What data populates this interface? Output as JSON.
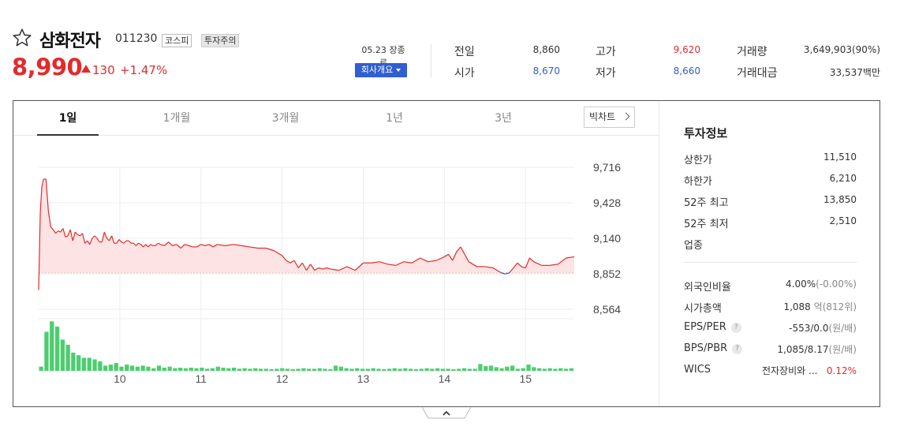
{
  "stock": {
    "name": "삼화전자",
    "code": "011230",
    "market_badge": "코스피",
    "warning_badge": "투자주의",
    "price": "8,990",
    "change": "130",
    "change_rate": "+1.47%",
    "close_info": "05.23 장종료",
    "company_button": "회사개요"
  },
  "quote": {
    "prev_label": "전일",
    "prev_value": "8,860",
    "open_label": "시가",
    "open_value": "8,670",
    "high_label": "고가",
    "high_value": "9,620",
    "low_label": "저가",
    "low_value": "8,660",
    "volume_label": "거래량",
    "volume_value": "3,649,903(90%)",
    "amount_label": "거래대금",
    "amount_value": "33,537백만"
  },
  "tabs": [
    {
      "label": "1일",
      "active": true
    },
    {
      "label": "1개월",
      "active": false
    },
    {
      "label": "3개월",
      "active": false
    },
    {
      "label": "1년",
      "active": false
    },
    {
      "label": "3년",
      "active": false
    }
  ],
  "candle_button": "빅차트",
  "side": {
    "title": "투자정보",
    "items": [
      {
        "label": "상한가",
        "value": "11,510"
      },
      {
        "label": "하한가",
        "value": "6,210"
      },
      {
        "label": "52주 최고",
        "value": "13,850"
      },
      {
        "label": "52주 최저",
        "value": "2,510"
      },
      {
        "label": "업종",
        "value": ""
      }
    ],
    "foreign_label": "외국인비율",
    "foreign_value": "4.00%",
    "foreign_sub": "(-0.00%)",
    "mcap_label": "시가총액",
    "mcap_value": "1,088",
    "mcap_unit": "억",
    "mcap_sub": "(812위)",
    "eps_label": "EPS/PER",
    "eps_value": "-553/0.0",
    "eps_sub": "(원/배)",
    "bps_label": "BPS/PBR",
    "bps_value": "1,085/8.17",
    "bps_sub": "(원/배)",
    "wics_label": "WICS",
    "wics_value": "전자장비와 ...",
    "wics_rate": "0.12%",
    "help_icon": "?"
  },
  "colors": {
    "up": "#e22b2b",
    "down": "#2f5fd0",
    "volume": "#4cce6e",
    "area": "#fde3e3"
  },
  "chart_data": {
    "type": "line",
    "title": "",
    "xlabel": "",
    "ylabel": "",
    "base_price": 8860,
    "ylim": [
      8564,
      9716
    ],
    "y_ticks": [
      9716,
      9428,
      9140,
      8852,
      8564
    ],
    "x_ticks": [
      10,
      11,
      12,
      13,
      14,
      15
    ],
    "x_range": [
      9.0,
      15.6
    ],
    "price_series": {
      "name": "",
      "x": [
        9.0,
        9.02,
        9.04,
        9.06,
        9.09,
        9.12,
        9.15,
        9.18,
        9.21,
        9.24,
        9.27,
        9.3,
        9.33,
        9.36,
        9.39,
        9.42,
        9.45,
        9.48,
        9.51,
        9.54,
        9.57,
        9.6,
        9.63,
        9.66,
        9.69,
        9.72,
        9.75,
        9.78,
        9.81,
        9.84,
        9.87,
        9.9,
        9.93,
        9.96,
        9.99,
        10.02,
        10.05,
        10.08,
        10.11,
        10.14,
        10.17,
        10.2,
        10.23,
        10.26,
        10.29,
        10.32,
        10.35,
        10.38,
        10.41,
        10.44,
        10.47,
        10.5,
        10.55,
        10.6,
        10.65,
        10.7,
        10.75,
        10.8,
        10.85,
        10.9,
        10.95,
        11.0,
        11.05,
        11.1,
        11.15,
        11.2,
        11.3,
        11.4,
        11.5,
        11.6,
        11.7,
        11.8,
        11.9,
        12.0,
        12.05,
        12.1,
        12.15,
        12.2,
        12.25,
        12.3,
        12.35,
        12.4,
        12.45,
        12.5,
        12.55,
        12.6,
        12.7,
        12.8,
        12.9,
        13.0,
        13.1,
        13.2,
        13.3,
        13.4,
        13.5,
        13.6,
        13.7,
        13.8,
        13.9,
        14.0,
        14.05,
        14.1,
        14.15,
        14.2,
        14.25,
        14.3,
        14.4,
        14.5,
        14.6,
        14.65,
        14.7,
        14.75,
        14.8,
        14.85,
        14.9,
        14.95,
        15.0,
        15.05,
        15.1,
        15.2,
        15.3,
        15.4,
        15.5,
        15.6
      ],
      "values": [
        8720,
        9350,
        9560,
        9620,
        9620,
        9360,
        9230,
        9210,
        9180,
        9200,
        9190,
        9220,
        9150,
        9160,
        9210,
        9120,
        9190,
        9170,
        9160,
        9180,
        9100,
        9120,
        9090,
        9140,
        9160,
        9140,
        9110,
        9110,
        9190,
        9140,
        9120,
        9160,
        9100,
        9100,
        9130,
        9110,
        9100,
        9120,
        9120,
        9100,
        9100,
        9080,
        9100,
        9090,
        9070,
        9090,
        9070,
        9090,
        9080,
        9080,
        9100,
        9090,
        9080,
        9110,
        9080,
        9090,
        9060,
        9090,
        9080,
        9070,
        9070,
        9090,
        9080,
        9090,
        9070,
        9090,
        9080,
        9090,
        9080,
        9070,
        9060,
        9060,
        9040,
        9000,
        8960,
        8940,
        8960,
        8900,
        8940,
        8880,
        8930,
        8880,
        8900,
        8890,
        8900,
        8890,
        8880,
        8910,
        8880,
        8940,
        8940,
        8950,
        8930,
        8920,
        8950,
        8940,
        8980,
        8950,
        8960,
        8990,
        9010,
        8960,
        9030,
        9070,
        9010,
        8950,
        8910,
        8910,
        8900,
        8880,
        8860,
        8850,
        8860,
        8900,
        8940,
        8910,
        8900,
        8980,
        8950,
        8920,
        8920,
        8930,
        8980,
        8990
      ]
    },
    "volume_series": {
      "name": "",
      "relative": [
        0.08,
        0.75,
        0.95,
        0.85,
        0.6,
        0.5,
        0.35,
        0.3,
        0.25,
        0.25,
        0.22,
        0.18,
        0.1,
        0.12,
        0.15,
        0.08,
        0.12,
        0.1,
        0.08,
        0.1,
        0.08,
        0.05,
        0.1,
        0.06,
        0.08,
        0.05,
        0.06,
        0.05,
        0.06,
        0.05,
        0.06,
        0.04,
        0.05,
        0.08,
        0.06,
        0.05,
        0.06,
        0.04,
        0.05,
        0.04,
        0.05,
        0.04,
        0.04,
        0.03,
        0.04,
        0.05,
        0.04,
        0.03,
        0.04,
        0.05,
        0.04,
        0.04,
        0.05,
        0.04,
        0.03,
        0.1,
        0.08,
        0.05,
        0.04,
        0.05,
        0.04,
        0.04,
        0.05,
        0.04,
        0.03,
        0.04,
        0.05,
        0.04,
        0.05,
        0.04,
        0.03,
        0.04,
        0.05,
        0.04,
        0.05,
        0.04,
        0.04,
        0.03,
        0.04,
        0.05,
        0.04,
        0.04,
        0.13,
        0.09,
        0.1,
        0.07,
        0.05,
        0.08,
        0.1,
        0.04,
        0.05,
        0.12,
        0.07,
        0.05,
        0.04,
        0.05,
        0.04,
        0.05,
        0.04,
        0.05
      ]
    }
  }
}
